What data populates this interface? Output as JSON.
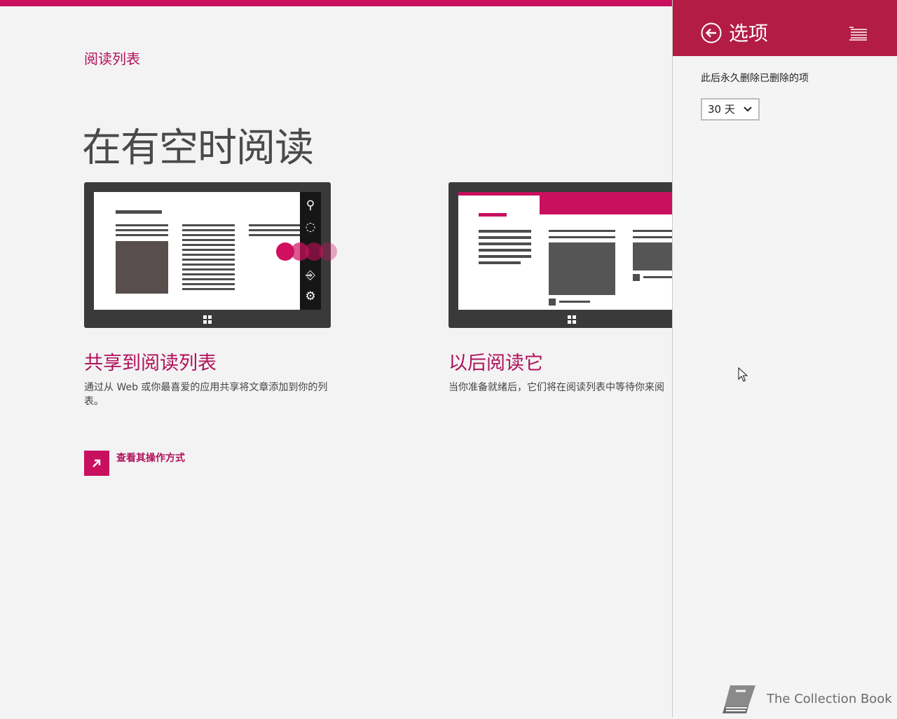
{
  "app": {
    "title": "阅读列表",
    "hero": "在有空时阅读"
  },
  "cards": [
    {
      "title": "共享到阅读列表",
      "description": "通过从 Web 或你最喜爱的应用共享将文章添加到你的列表。"
    },
    {
      "title": "以后阅读它",
      "description": "当你准备就绪后，它们将在阅读列表中等待你来阅"
    }
  ],
  "how_link": {
    "label": "查看其操作方式",
    "icon": "arrow-up-right-icon"
  },
  "flyout": {
    "title": "选项",
    "back_icon": "back-arrow-icon",
    "setting_label": "此后永久删除已删除的项",
    "select_value": "30 天"
  },
  "watermark": {
    "text": "The Collection Book",
    "icon": "book-icon"
  },
  "colors": {
    "accent": "#c8105f",
    "flyout_header": "#b21c45",
    "background": "#f3f3f3"
  }
}
